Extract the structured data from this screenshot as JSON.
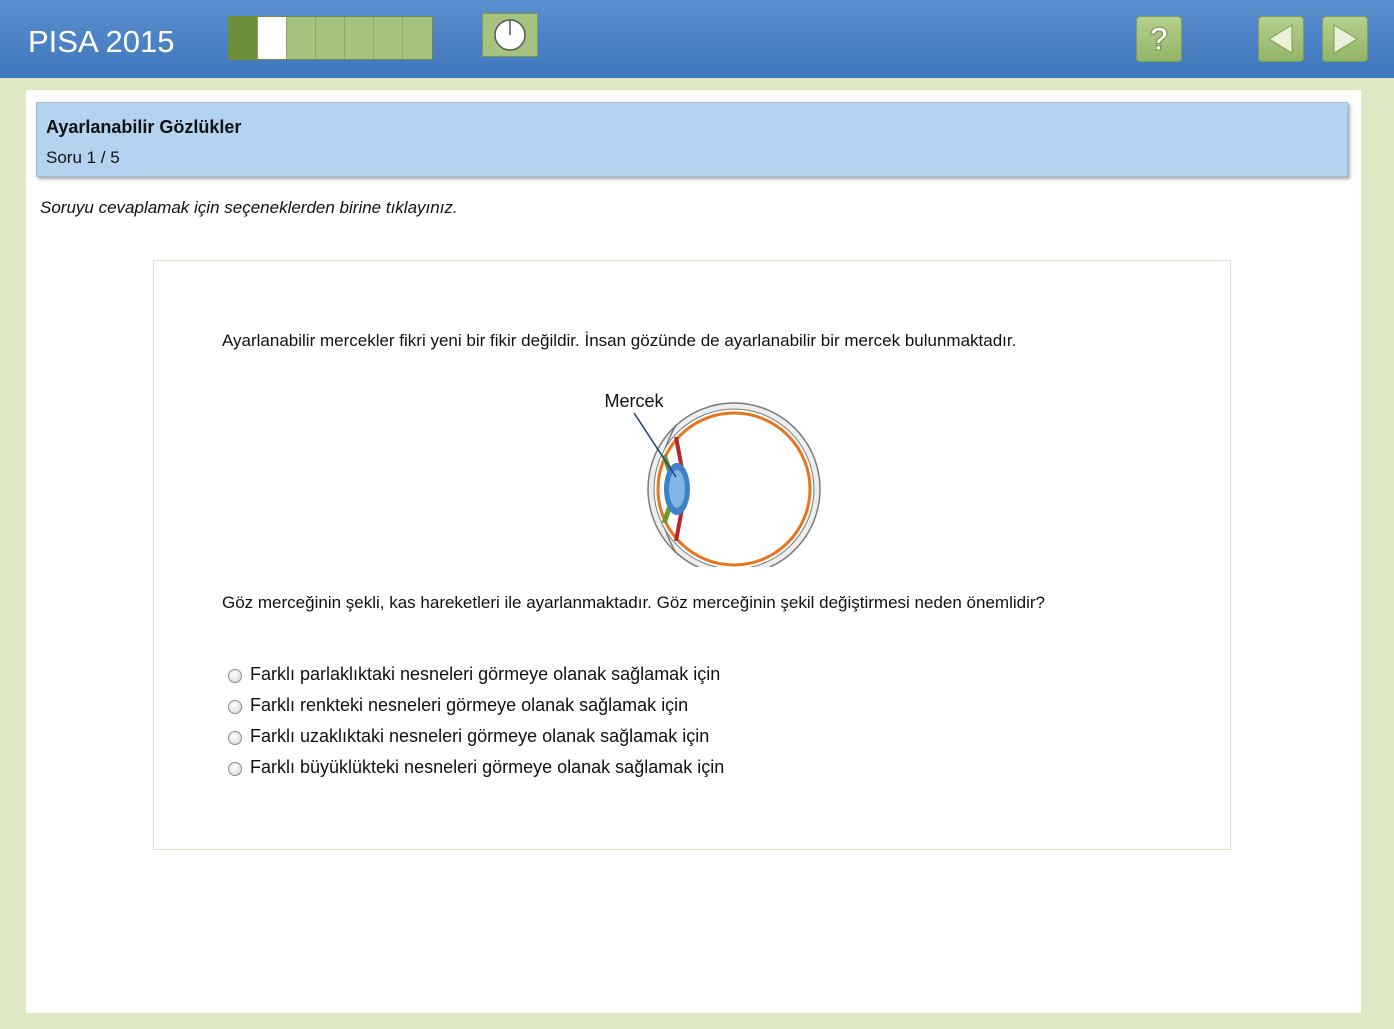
{
  "header": {
    "app_title": "PISA 2015",
    "progress": {
      "total_segments": 7,
      "done_segments": 1,
      "current_segment": 2
    }
  },
  "colors": {
    "topbar": "#4a82c6",
    "frame": "#dfe8c4",
    "header_box": "#b3d3f0",
    "progress_done": "#6e8f3a",
    "progress_pending": "#a6c27f"
  },
  "icons": {
    "timer": "clock-icon",
    "help": "question-mark-icon",
    "previous": "arrow-left-icon",
    "next": "arrow-right-icon"
  },
  "unit": {
    "title": "Ayarlanabilir Gözlükler",
    "question_number": "Soru 1 / 5"
  },
  "instruction": "Soruyu cevaplamak için seçeneklerden birine tıklayınız.",
  "stimulus": {
    "intro": "Ayarlanabilir mercekler fikri yeni bir fikir değildir. İnsan gözünde de ayarlanabilir bir mercek bulunmaktadır.",
    "figure_label": "Mercek",
    "question": "Göz merceğinin şekli, kas hareketleri ile ayarlanmaktadır. Göz merceğinin şekil değiştirmesi neden önemlidir?",
    "options": [
      "Farklı parlaklıktaki nesneleri görmeye olanak sağlamak için",
      "Farklı renkteki nesneleri görmeye olanak sağlamak için",
      "Farklı uzaklıktaki nesneleri görmeye olanak sağlamak için",
      "Farklı büyüklükteki nesneleri görmeye olanak sağlamak için"
    ]
  }
}
